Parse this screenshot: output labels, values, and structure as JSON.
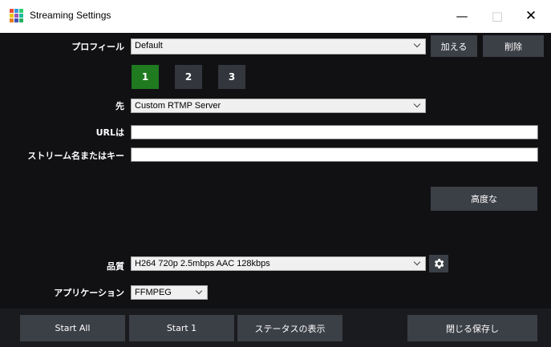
{
  "window": {
    "title": "Streaming Settings",
    "controls": {
      "minimize": "—",
      "maximize": "□",
      "close": "✕"
    },
    "icon_colors": [
      "#e74c3c",
      "#3498db",
      "#2ecc71",
      "#f1c40f",
      "#9b59b6",
      "#1abc9c",
      "#e67e22",
      "#3f51b5",
      "#27ae60"
    ]
  },
  "profile": {
    "label": "プロフィール",
    "value": "Default",
    "add_label": "加える",
    "delete_label": "削除"
  },
  "tabs": [
    {
      "label": "1",
      "active": true
    },
    {
      "label": "2",
      "active": false
    },
    {
      "label": "3",
      "active": false
    }
  ],
  "destination": {
    "label": "先",
    "value": "Custom RTMP Server"
  },
  "url": {
    "label": "URLは",
    "value": ""
  },
  "stream_key": {
    "label": "ストリーム名またはキー",
    "value": ""
  },
  "advanced_label": "高度な",
  "quality": {
    "label": "品質",
    "value": "H264 720p 2.5mbps AAC 128kbps"
  },
  "application": {
    "label": "アプリケーション",
    "value": "FFMPEG"
  },
  "bottom": {
    "start_all": "Start All",
    "start_one": "Start 1",
    "show_status": "ステータスの表示",
    "save_close": "閉じる保存し"
  },
  "colors": {
    "panel_bg": "#111114",
    "button_bg": "#3b3f46",
    "active_tab": "#1f7a20"
  }
}
